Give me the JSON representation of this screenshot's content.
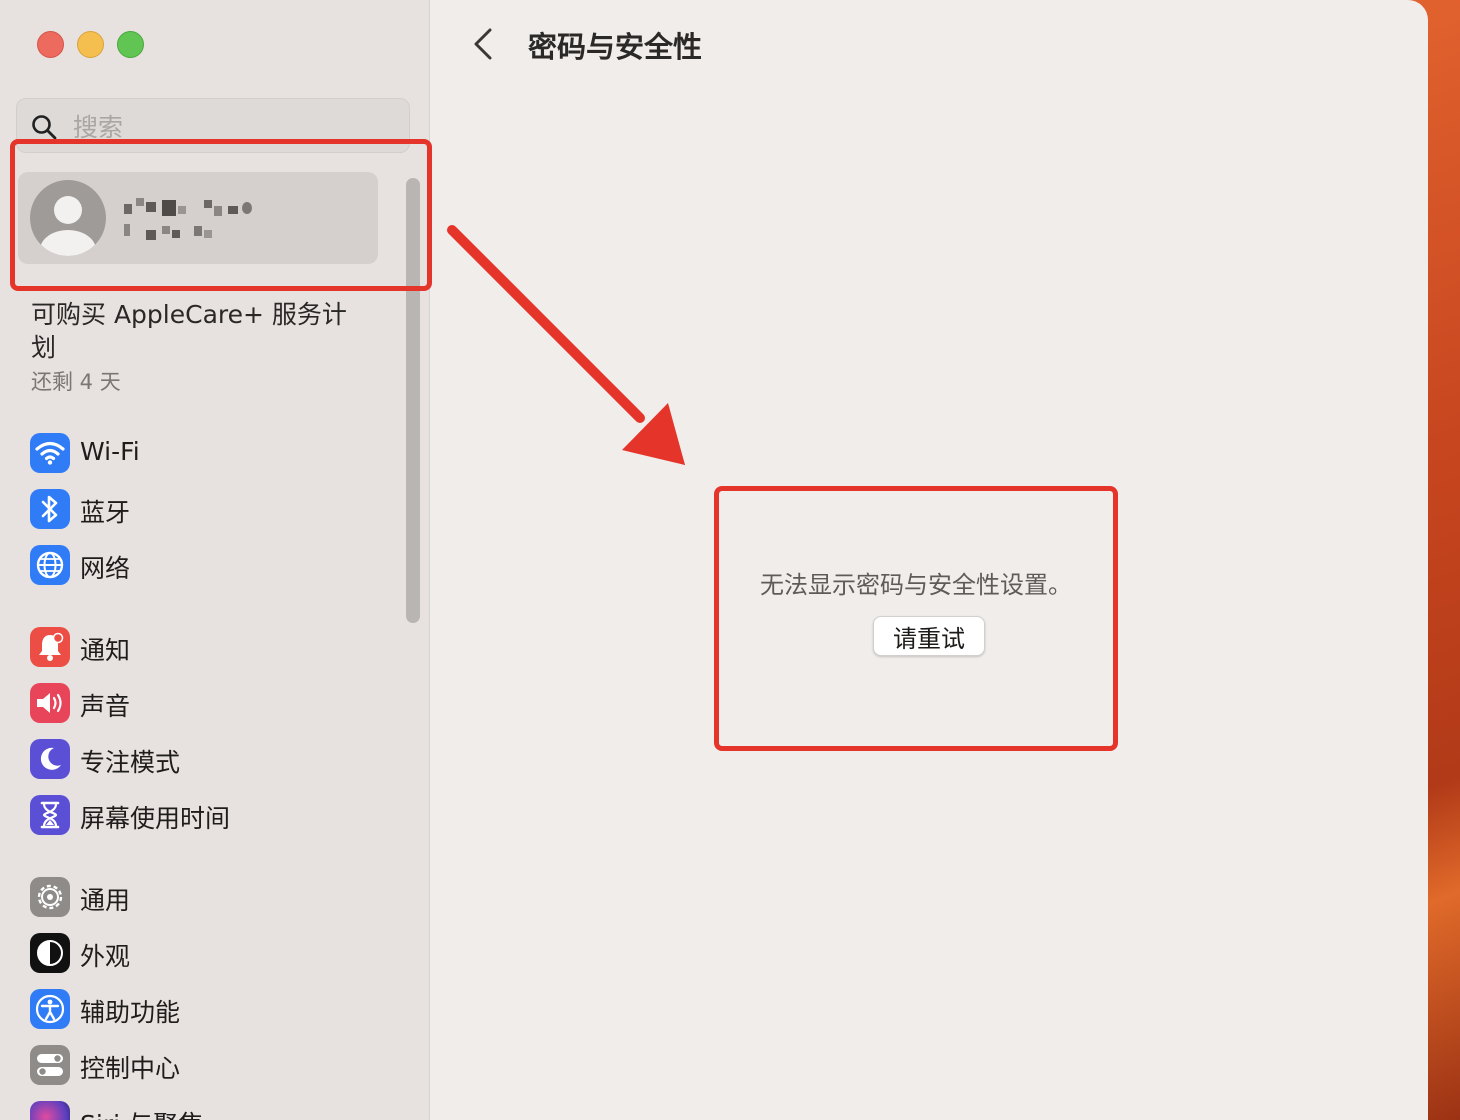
{
  "search": {
    "placeholder": "搜索"
  },
  "applecare": {
    "title": "可购买 AppleCare+ 服务计划",
    "subtitle": "还剩 4 天"
  },
  "sidebar": {
    "items": [
      {
        "label": "Wi-Fi",
        "icon": "wifi-icon",
        "color": "#2f7cf6"
      },
      {
        "label": "蓝牙",
        "icon": "bluetooth-icon",
        "color": "#2f7cf6"
      },
      {
        "label": "网络",
        "icon": "globe-icon",
        "color": "#2f7cf6"
      },
      {
        "label": "通知",
        "icon": "bell-icon",
        "color": "#ec4d45"
      },
      {
        "label": "声音",
        "icon": "speaker-icon",
        "color": "#e8445a"
      },
      {
        "label": "专注模式",
        "icon": "moon-icon",
        "color": "#5b4fd6"
      },
      {
        "label": "屏幕使用时间",
        "icon": "hourglass-icon",
        "color": "#5b4fd6"
      },
      {
        "label": "通用",
        "icon": "gear-icon",
        "color": "#8e8b89"
      },
      {
        "label": "外观",
        "icon": "appearance-icon",
        "color": "#111111"
      },
      {
        "label": "辅助功能",
        "icon": "accessibility-icon",
        "color": "#2f7cf6"
      },
      {
        "label": "控制中心",
        "icon": "toggles-icon",
        "color": "#8e8b89"
      },
      {
        "label": "Siri 与聚焦",
        "icon": "siri-icon",
        "color": "#6a3f9a"
      }
    ]
  },
  "main": {
    "title": "密码与安全性",
    "error_message": "无法显示密码与安全性设置。",
    "retry_label": "请重试"
  },
  "annotation_color": "#e5352b"
}
